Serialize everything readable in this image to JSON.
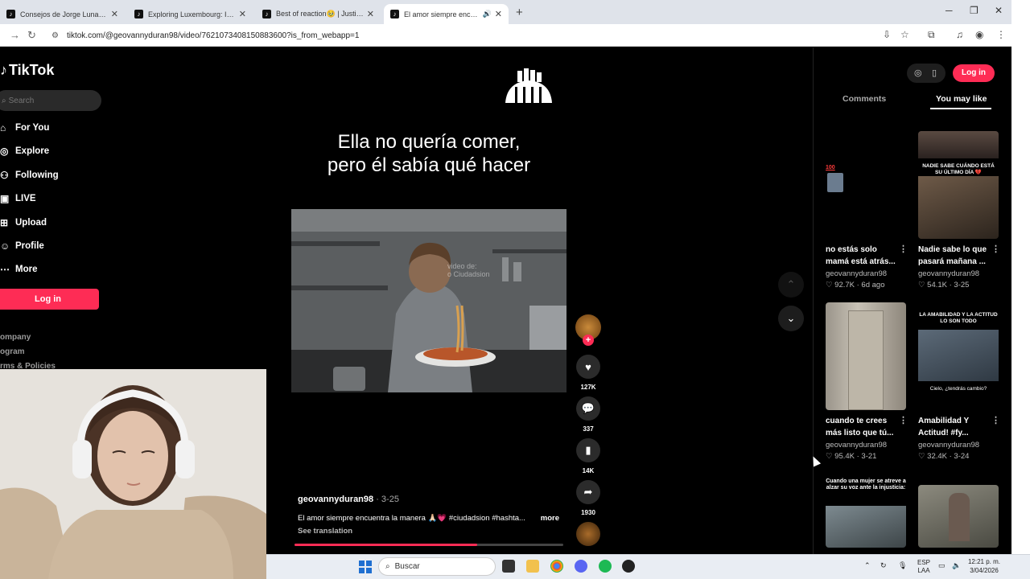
{
  "browser": {
    "tabs": [
      {
        "title": "Consejos de Jorge Luna para la",
        "active": false,
        "audio": false
      },
      {
        "title": "Exploring Luxembourg: Insights",
        "active": false,
        "audio": false
      },
      {
        "title": "Best of reaction🥹 | Justin bieb",
        "active": false,
        "audio": false
      },
      {
        "title": "El amor siempre encuentra",
        "active": true,
        "audio": true
      }
    ],
    "new_tab": "+",
    "url": "tiktok.com/@geovannyduran98/video/7621073408150883600?is_from_webapp=1"
  },
  "tiktok": {
    "logo": "TikTok",
    "search_placeholder": "Search",
    "nav": [
      {
        "label": "For You",
        "icon": "home-icon"
      },
      {
        "label": "Explore",
        "icon": "compass-icon"
      },
      {
        "label": "Following",
        "icon": "following-icon"
      },
      {
        "label": "LIVE",
        "icon": "live-icon"
      },
      {
        "label": "Upload",
        "icon": "upload-icon"
      },
      {
        "label": "Profile",
        "icon": "profile-icon"
      },
      {
        "label": "More",
        "icon": "more-icon"
      }
    ],
    "login": "Log in",
    "footer": [
      "ompany",
      "ogram",
      "rms & Policies"
    ]
  },
  "video": {
    "headline_line1": "Ella no quería comer,",
    "headline_line2": "pero él sabía qué hacer",
    "watermark_line1": "video de:",
    "watermark_line2": "o Ciudadsion",
    "username": "geovannyduran98",
    "date": " · 3-25",
    "description": "El amor siempre encuentra la manera 🙏🏻💗 #ciudadsion #hashta...",
    "more": "more",
    "see_translation": "See translation",
    "progress_fraction": 0.68,
    "actions": {
      "likes": "127K",
      "comments": "337",
      "saves": "14K",
      "shares": "1930"
    }
  },
  "panel": {
    "login": "Log in",
    "tabs": {
      "comments": "Comments",
      "you_may_like": "You may like"
    },
    "cards": [
      {
        "title1": "no estás solo",
        "title2": "mamá está atrás...",
        "user": "geovannyduran98",
        "stats": "♡ 92.7K · 6d ago",
        "cap": "100"
      },
      {
        "title1": "Nadie sabe lo que",
        "title2": "pasará mañana ...",
        "user": "geovannyduran98",
        "stats": "♡ 54.1K · 3-25",
        "cap": "NADIE SABE CUÁNDO ESTÁ SU ÚLTIMO DÍA 💔"
      },
      {
        "title1": "cuando te crees",
        "title2": "más listo que tú...",
        "user": "geovannyduran98",
        "stats": "♡ 95.4K · 3-21",
        "cap": ""
      },
      {
        "title1": "Amabilidad Y",
        "title2": "Actitud! #fy...",
        "user": "geovannyduran98",
        "stats": "♡ 32.4K · 3-24",
        "cap": "LA AMABILIDAD Y LA ACTITUD LO SON TODO",
        "cap2": "Cielo, ¿tendrás cambio?"
      },
      {
        "cap": "Cuando una mujer se atreve a alzar su voz ante la injusticia:"
      },
      {
        "cap": ""
      }
    ]
  },
  "taskbar": {
    "search": "Buscar",
    "lang1": "ESP",
    "lang2": "LAA",
    "time": "12:21 p. m.",
    "date": "3/04/2026"
  }
}
